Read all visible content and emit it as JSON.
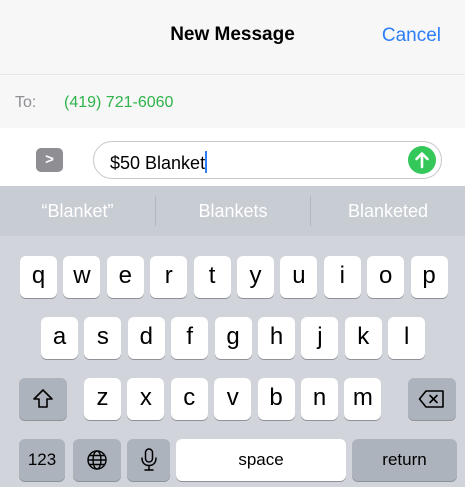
{
  "header": {
    "title": "New Message",
    "cancel_label": "Cancel"
  },
  "recipient": {
    "label": "To:",
    "value": "(419) 721-6060"
  },
  "compose": {
    "text": "$50 Blanket",
    "apps_glyph": ">"
  },
  "suggestions": [
    "“Blanket”",
    "Blankets",
    "Blanketed"
  ],
  "keyboard": {
    "row1": [
      "q",
      "w",
      "e",
      "r",
      "t",
      "y",
      "u",
      "i",
      "o",
      "p"
    ],
    "row2": [
      "a",
      "s",
      "d",
      "f",
      "g",
      "h",
      "j",
      "k",
      "l"
    ],
    "row3": [
      "z",
      "x",
      "c",
      "v",
      "b",
      "n",
      "m"
    ],
    "numbers_label": "123",
    "space_label": "space",
    "return_label": "return"
  },
  "colors": {
    "accent": "#2d7ff9",
    "recipient_green": "#2fb34a",
    "send_green": "#34c759"
  },
  "icons": [
    "chevron-right-icon",
    "send-arrow-icon",
    "shift-icon",
    "backspace-icon",
    "globe-icon",
    "microphone-icon"
  ]
}
